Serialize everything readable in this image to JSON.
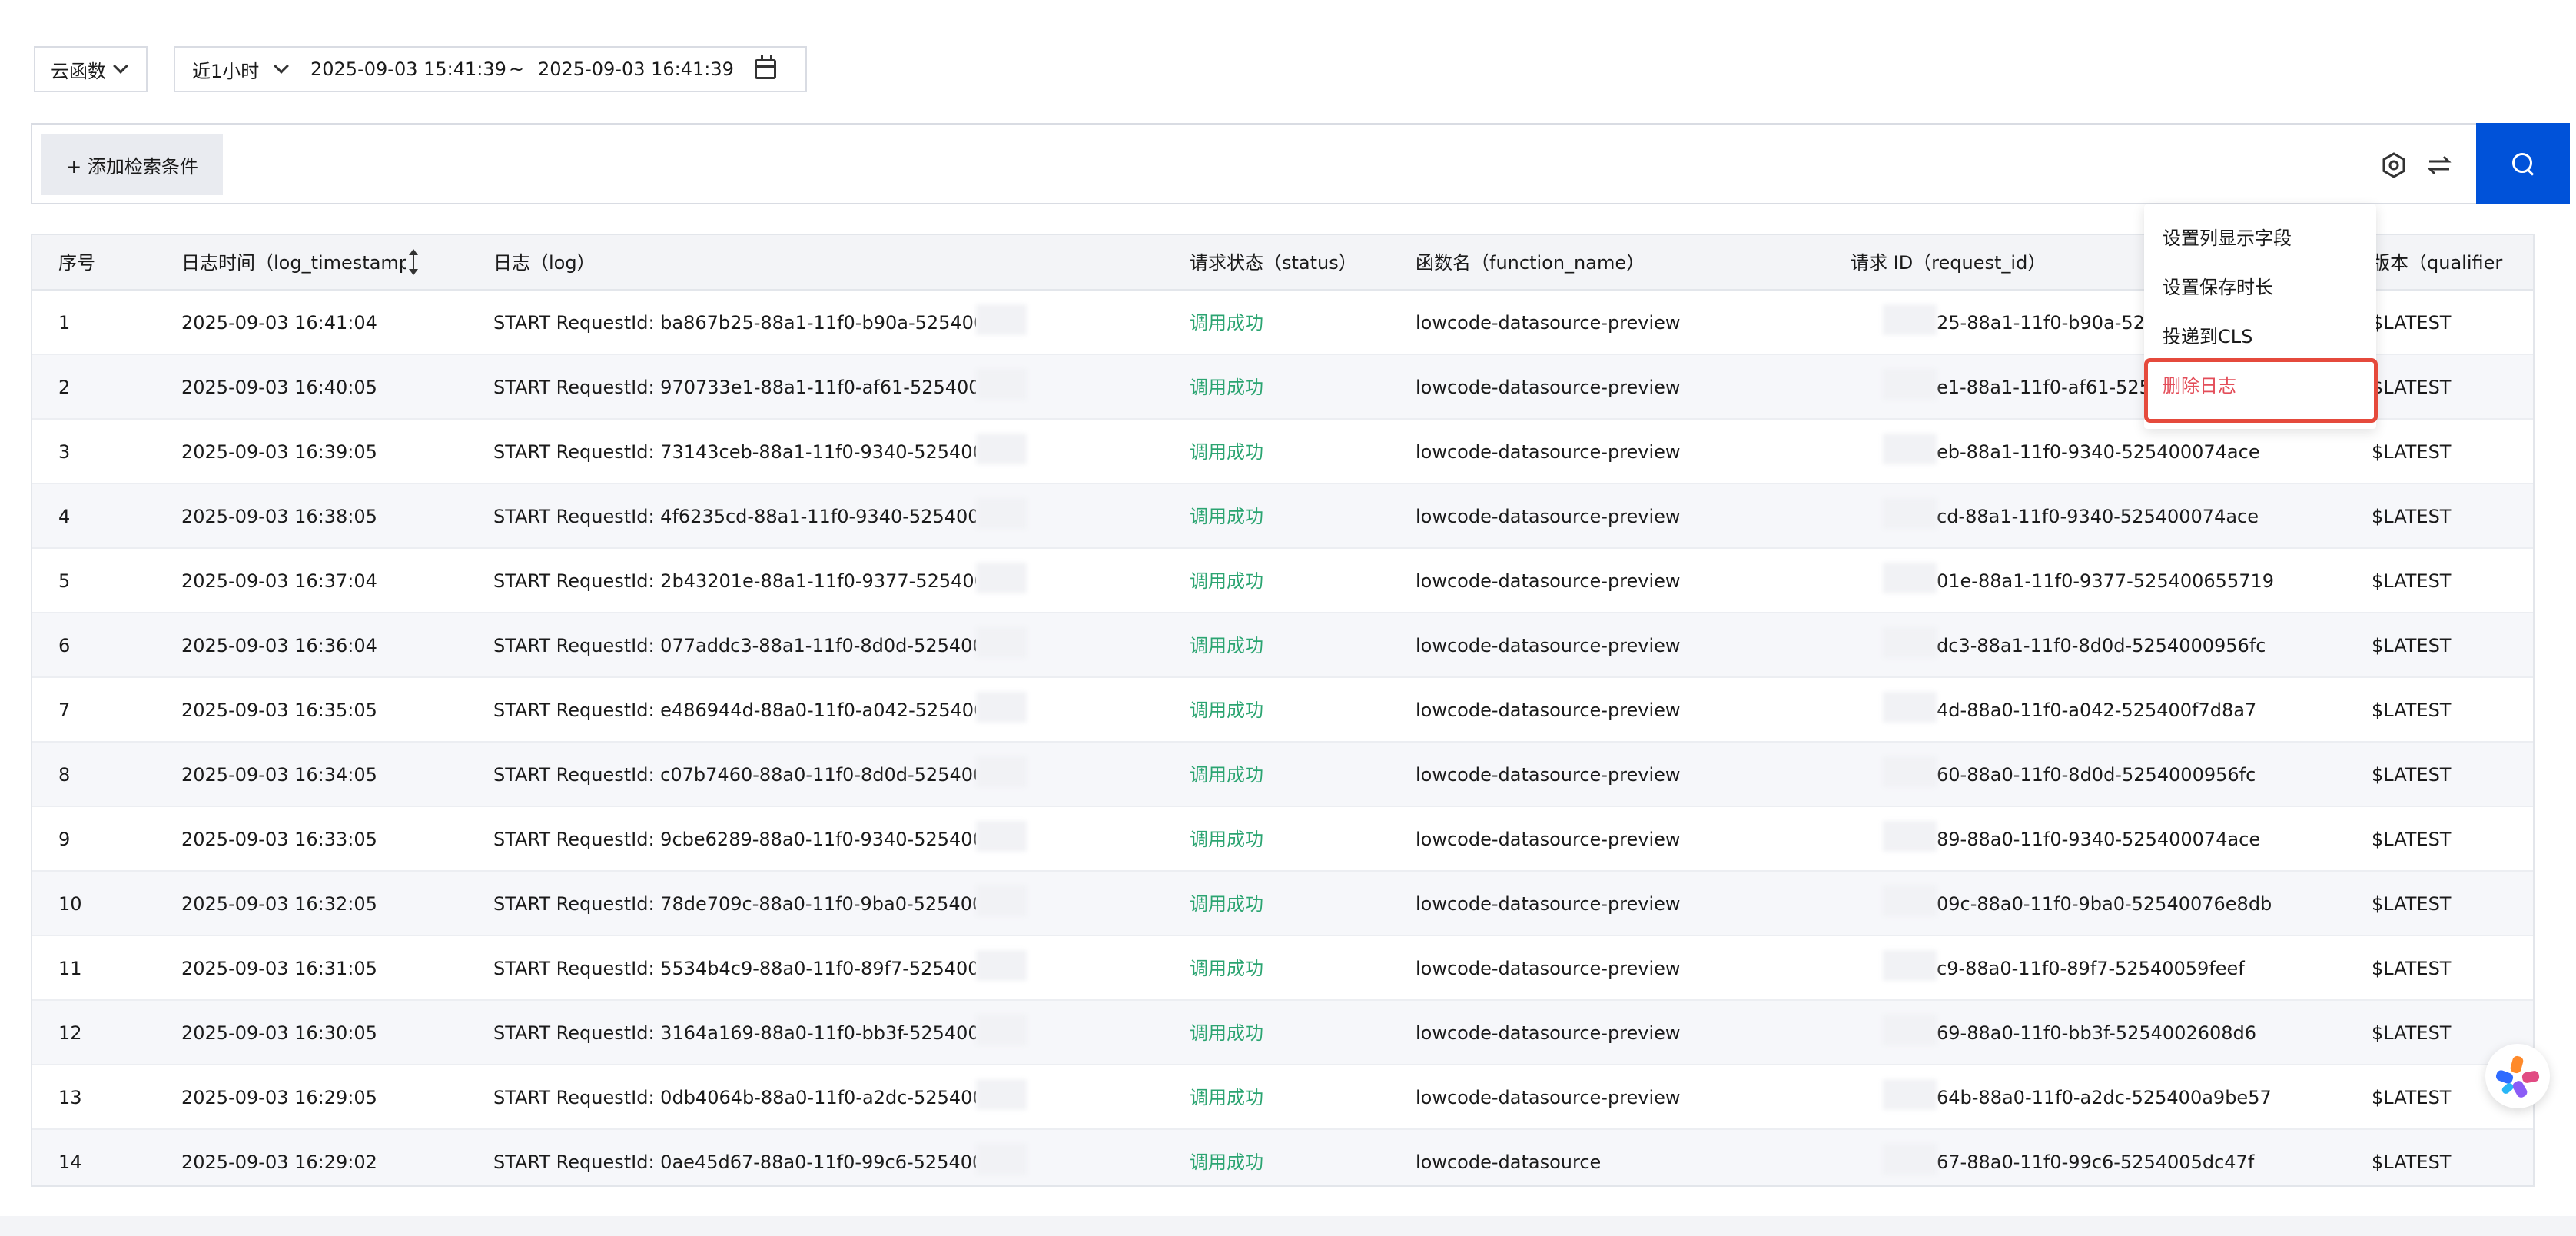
{
  "filters": {
    "source": "云函数",
    "range_preset": "近1小时",
    "start": "2025-09-03 15:41:39",
    "separator": "~",
    "end": "2025-09-03 16:41:39"
  },
  "search": {
    "add_condition": "+ 添加检索条件"
  },
  "columns": {
    "index": "序号",
    "timestamp": "日志时间（log_timestamp",
    "log": "日志（log）",
    "status": "请求状态（status）",
    "function": "函数名（function_name）",
    "request": "请求 ID（request_id）",
    "version": "版本（qualifier"
  },
  "rows": [
    {
      "index": "1",
      "time": "2025-09-03 16:41:04",
      "log": "START RequestId: ba867b25-88a1-11f0-b90a-525400",
      "status": "调用成功",
      "function": "lowcode-datasource-preview",
      "request": "25-88a1-11f0-b90a-525400c",
      "version": "$LATEST"
    },
    {
      "index": "2",
      "time": "2025-09-03 16:40:05",
      "log": "START RequestId: 970733e1-88a1-11f0-af61-5254009",
      "status": "调用成功",
      "function": "lowcode-datasource-preview",
      "request": "e1-88a1-11f0-af61-5254009",
      "version": "$LATEST"
    },
    {
      "index": "3",
      "time": "2025-09-03 16:39:05",
      "log": "START RequestId: 73143ceb-88a1-11f0-9340-525400",
      "status": "调用成功",
      "function": "lowcode-datasource-preview",
      "request": "eb-88a1-11f0-9340-525400074ace",
      "version": "$LATEST"
    },
    {
      "index": "4",
      "time": "2025-09-03 16:38:05",
      "log": "START RequestId: 4f6235cd-88a1-11f0-9340-525400",
      "status": "调用成功",
      "function": "lowcode-datasource-preview",
      "request": "cd-88a1-11f0-9340-525400074ace",
      "version": "$LATEST"
    },
    {
      "index": "5",
      "time": "2025-09-03 16:37:04",
      "log": "START RequestId: 2b43201e-88a1-11f0-9377-525400",
      "status": "调用成功",
      "function": "lowcode-datasource-preview",
      "request": "01e-88a1-11f0-9377-525400655719",
      "version": "$LATEST"
    },
    {
      "index": "6",
      "time": "2025-09-03 16:36:04",
      "log": "START RequestId: 077addc3-88a1-11f0-8d0d-525400",
      "status": "调用成功",
      "function": "lowcode-datasource-preview",
      "request": "dc3-88a1-11f0-8d0d-5254000956fc",
      "version": "$LATEST"
    },
    {
      "index": "7",
      "time": "2025-09-03 16:35:05",
      "log": "START RequestId: e486944d-88a0-11f0-a042-525400",
      "status": "调用成功",
      "function": "lowcode-datasource-preview",
      "request": "4d-88a0-11f0-a042-525400f7d8a7",
      "version": "$LATEST"
    },
    {
      "index": "8",
      "time": "2025-09-03 16:34:05",
      "log": "START RequestId: c07b7460-88a0-11f0-8d0d-525400",
      "status": "调用成功",
      "function": "lowcode-datasource-preview",
      "request": "60-88a0-11f0-8d0d-5254000956fc",
      "version": "$LATEST"
    },
    {
      "index": "9",
      "time": "2025-09-03 16:33:05",
      "log": "START RequestId: 9cbe6289-88a0-11f0-9340-525400",
      "status": "调用成功",
      "function": "lowcode-datasource-preview",
      "request": "89-88a0-11f0-9340-525400074ace",
      "version": "$LATEST"
    },
    {
      "index": "10",
      "time": "2025-09-03 16:32:05",
      "log": "START RequestId: 78de709c-88a0-11f0-9ba0-525400",
      "status": "调用成功",
      "function": "lowcode-datasource-preview",
      "request": "09c-88a0-11f0-9ba0-52540076e8db",
      "version": "$LATEST"
    },
    {
      "index": "11",
      "time": "2025-09-03 16:31:05",
      "log": "START RequestId: 5534b4c9-88a0-11f0-89f7-525400",
      "status": "调用成功",
      "function": "lowcode-datasource-preview",
      "request": "c9-88a0-11f0-89f7-52540059feef",
      "version": "$LATEST"
    },
    {
      "index": "12",
      "time": "2025-09-03 16:30:05",
      "log": "START RequestId: 3164a169-88a0-11f0-bb3f-525400",
      "status": "调用成功",
      "function": "lowcode-datasource-preview",
      "request": "69-88a0-11f0-bb3f-5254002608d6",
      "version": "$LATEST"
    },
    {
      "index": "13",
      "time": "2025-09-03 16:29:05",
      "log": "START RequestId: 0db4064b-88a0-11f0-a2dc-525400",
      "status": "调用成功",
      "function": "lowcode-datasource-preview",
      "request": "64b-88a0-11f0-a2dc-525400a9be57",
      "version": "$LATEST"
    },
    {
      "index": "14",
      "time": "2025-09-03 16:29:02",
      "log": "START RequestId: 0ae45d67-88a0-11f0-99c6-525400",
      "status": "调用成功",
      "function": "lowcode-datasource",
      "request": "67-88a0-11f0-99c6-5254005dc47f",
      "version": "$LATEST"
    }
  ],
  "menu": {
    "items": [
      "设置列显示字段",
      "设置保存时长",
      "投递到CLS",
      "删除日志"
    ]
  },
  "colors": {
    "primary": "#0052d9",
    "success": "#2ba471",
    "danger": "#e34d59",
    "highlight": "#e54a3c"
  }
}
